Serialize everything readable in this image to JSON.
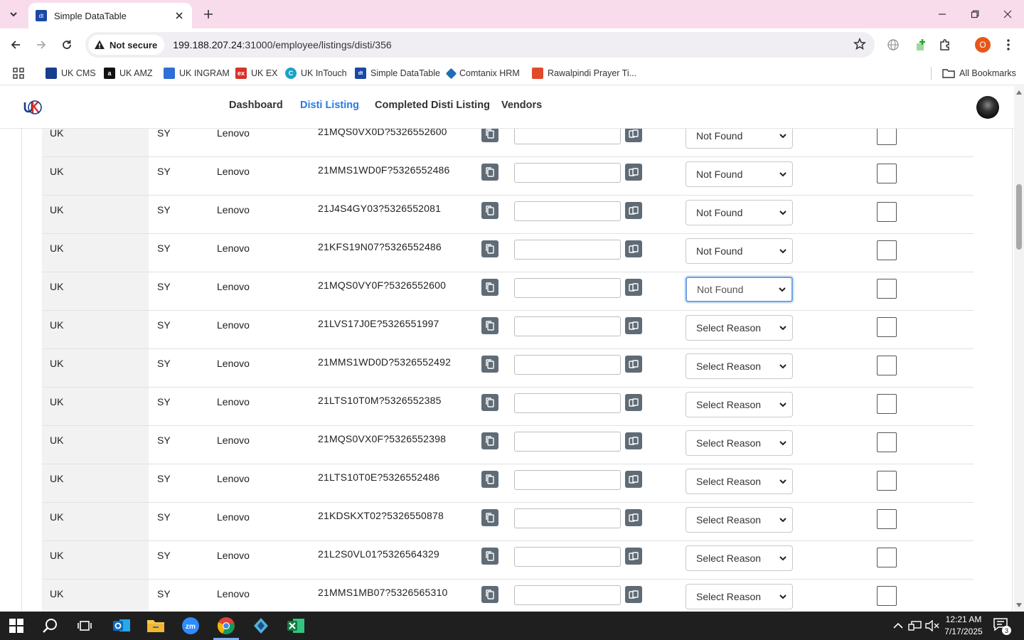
{
  "browser": {
    "tab_title": "Simple DataTable",
    "favicon_text": "dt",
    "not_secure_label": "Not secure",
    "url_host": "199.188.207.24",
    "url_rest": ":31000/employee/listings/disti/356",
    "profile_initial": "O"
  },
  "bookmarks": [
    {
      "label": "UK CMS",
      "icon": "uk-cms-icon",
      "color": "#1a3c8c",
      "glyph": ""
    },
    {
      "label": "UK AMZ",
      "icon": "amazon-icon",
      "color": "#111111",
      "glyph": "a"
    },
    {
      "label": "UK INGRAM",
      "icon": "ingram-icon",
      "color": "#2f6fd6",
      "glyph": ""
    },
    {
      "label": "UK EX",
      "icon": "ex-icon",
      "color": "#d6332a",
      "glyph": "ex"
    },
    {
      "label": "UK InTouch",
      "icon": "intouch-icon",
      "color": "#19a2c9",
      "glyph": "C"
    },
    {
      "label": "Simple DataTable",
      "icon": "datatable-icon",
      "color": "#1a47a8",
      "glyph": "dt"
    },
    {
      "label": "Comtanix HRM",
      "icon": "comtanix-icon",
      "color": "#1c6fb8",
      "glyph": ""
    },
    {
      "label": "Rawalpindi Prayer Ti...",
      "icon": "prayer-icon",
      "color": "#e24a2a",
      "glyph": ""
    }
  ],
  "all_bookmarks_label": "All Bookmarks",
  "nav": {
    "dashboard": "Dashboard",
    "disti_listing": "Disti Listing",
    "completed": "Completed Disti Listing",
    "vendors": "Vendors",
    "active_color": "#2a7ae2"
  },
  "rows": [
    {
      "country": "UK",
      "code": "SY",
      "brand": "Lenovo",
      "part": "21MQS0VX0D?5326552600",
      "reason": "Not Found"
    },
    {
      "country": "UK",
      "code": "SY",
      "brand": "Lenovo",
      "part": "21MMS1WD0F?5326552486",
      "reason": "Not Found"
    },
    {
      "country": "UK",
      "code": "SY",
      "brand": "Lenovo",
      "part": "21J4S4GY03?5326552081",
      "reason": "Not Found"
    },
    {
      "country": "UK",
      "code": "SY",
      "brand": "Lenovo",
      "part": "21KFS19N07?5326552486",
      "reason": "Not Found"
    },
    {
      "country": "UK",
      "code": "SY",
      "brand": "Lenovo",
      "part": "21MQS0VY0F?5326552600",
      "reason": "Not Found",
      "focused": true
    },
    {
      "country": "UK",
      "code": "SY",
      "brand": "Lenovo",
      "part": "21LVS17J0E?5326551997",
      "reason": "Select Reason"
    },
    {
      "country": "UK",
      "code": "SY",
      "brand": "Lenovo",
      "part": "21MMS1WD0D?5326552492",
      "reason": "Select Reason"
    },
    {
      "country": "UK",
      "code": "SY",
      "brand": "Lenovo",
      "part": "21LTS10T0M?5326552385",
      "reason": "Select Reason"
    },
    {
      "country": "UK",
      "code": "SY",
      "brand": "Lenovo",
      "part": "21MQS0VX0F?5326552398",
      "reason": "Select Reason"
    },
    {
      "country": "UK",
      "code": "SY",
      "brand": "Lenovo",
      "part": "21LTS10T0E?5326552486",
      "reason": "Select Reason"
    },
    {
      "country": "UK",
      "code": "SY",
      "brand": "Lenovo",
      "part": "21KDSKXT02?5326550878",
      "reason": "Select Reason"
    },
    {
      "country": "UK",
      "code": "SY",
      "brand": "Lenovo",
      "part": "21L2S0VL01?5326564329",
      "reason": "Select Reason"
    },
    {
      "country": "UK",
      "code": "SY",
      "brand": "Lenovo",
      "part": "21MMS1MB07?5326565310",
      "reason": "Select Reason"
    }
  ],
  "taskbar": {
    "time": "12:21 AM",
    "date": "7/17/2025",
    "notification_count": "3",
    "chrome_badge": "O",
    "apps": [
      "start-icon",
      "search-icon",
      "task-view-icon",
      "outlook-icon",
      "file-explorer-icon",
      "zoom-icon",
      "chrome-icon",
      "app-icon",
      "excel-icon"
    ]
  }
}
